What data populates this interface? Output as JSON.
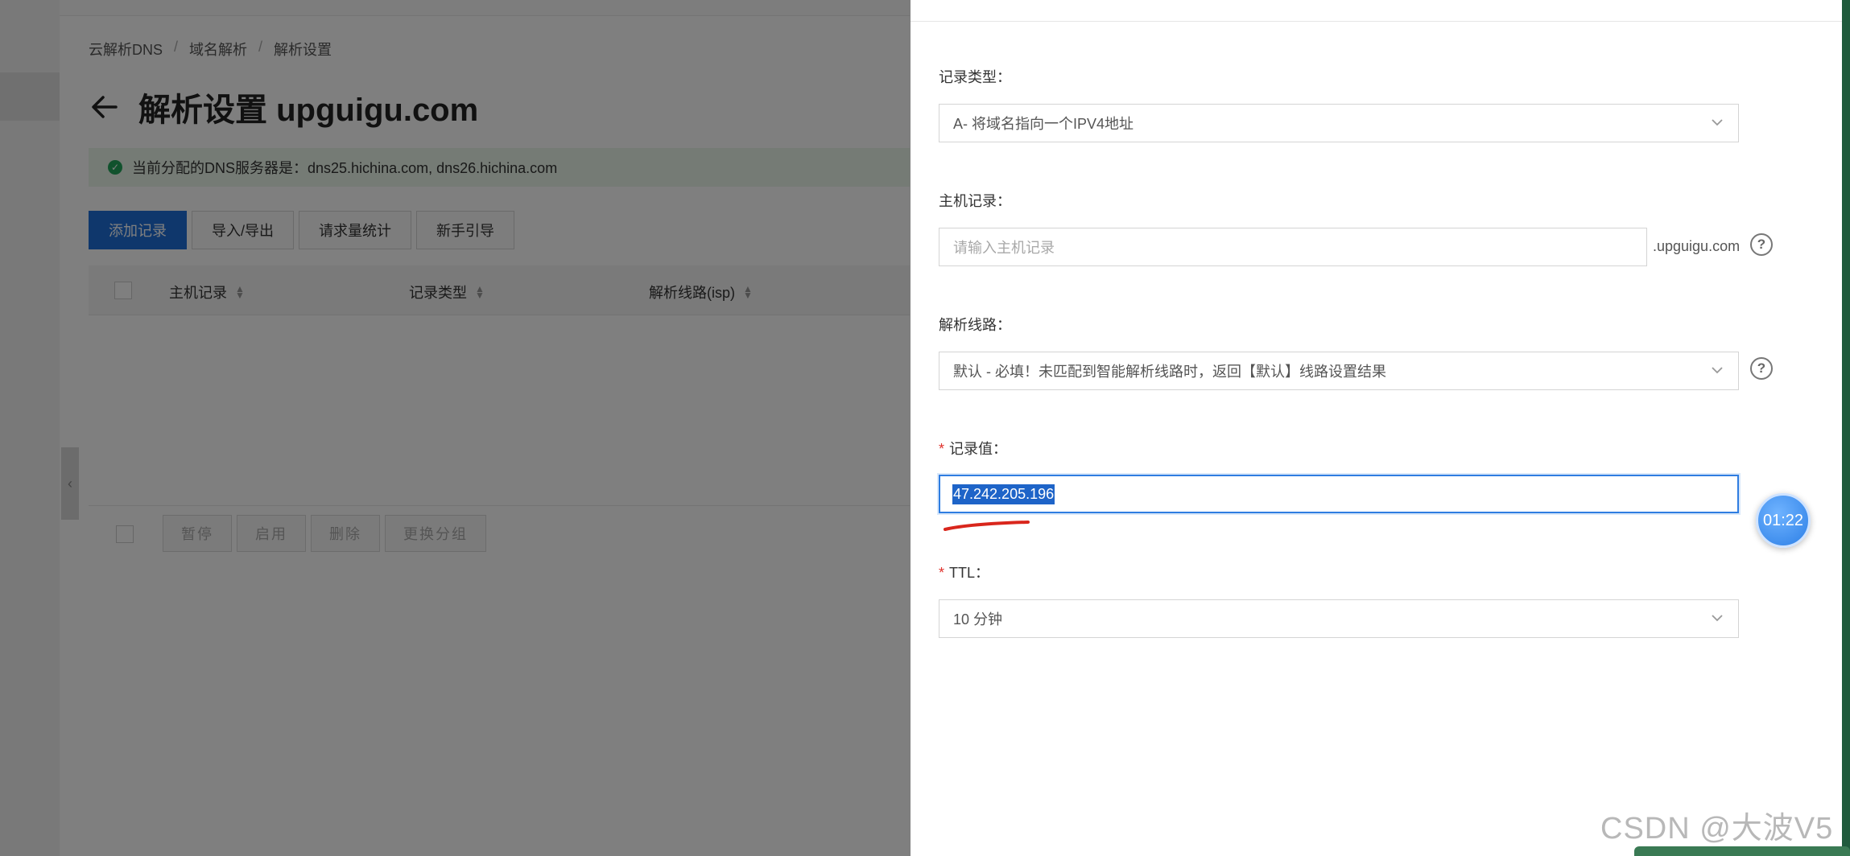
{
  "breadcrumb": {
    "items": [
      "云解析DNS",
      "域名解析",
      "解析设置"
    ],
    "separator": "/"
  },
  "page": {
    "title": "解析设置 upguigu.com"
  },
  "notice": {
    "text": "当前分配的DNS服务器是：dns25.hichina.com, dns26.hichina.com"
  },
  "toolbar": {
    "add_record": "添加记录",
    "import_export": "导入/导出",
    "request_stats": "请求量统计",
    "beginner_guide": "新手引导"
  },
  "table": {
    "columns": [
      "主机记录",
      "记录类型",
      "解析线路(isp)"
    ]
  },
  "batch": {
    "pause": "暂停",
    "enable": "启用",
    "delete": "删除",
    "change_group": "更换分组"
  },
  "drawer": {
    "record_type": {
      "label": "记录类型：",
      "value": "A- 将域名指向一个IPV4地址"
    },
    "host_record": {
      "label": "主机记录：",
      "placeholder": "请输入主机记录",
      "suffix": ".upguigu.com"
    },
    "line": {
      "label": "解析线路：",
      "value": "默认 - 必填！未匹配到智能解析线路时，返回【默认】线路设置结果"
    },
    "record_value": {
      "label": "记录值：",
      "value": "47.242.205.196"
    },
    "ttl": {
      "label": "TTL：",
      "value": "10 分钟"
    }
  },
  "timer": {
    "text": "01:22"
  },
  "watermark": {
    "text": "CSDN @大波V5"
  },
  "colors": {
    "primary": "#1e6fd9",
    "success": "#22a45a",
    "required": "#e0322c",
    "annotation": "#d9261c"
  }
}
